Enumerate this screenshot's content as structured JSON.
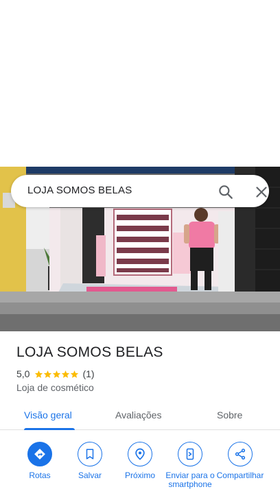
{
  "search": {
    "query": "LOJA SOMOS BELAS"
  },
  "place": {
    "name": "LOJA SOMOS BELAS",
    "rating": "5,0",
    "star_count": 5,
    "review_count": "(1)",
    "category": "Loja de cosmético"
  },
  "tabs": [
    {
      "label": "Visão geral",
      "active": true
    },
    {
      "label": "Avaliações",
      "active": false
    },
    {
      "label": "Sobre",
      "active": false
    }
  ],
  "actions": [
    {
      "label": "Rotas",
      "icon": "directions-icon"
    },
    {
      "label": "Salvar",
      "icon": "bookmark-icon"
    },
    {
      "label": "Próximo",
      "icon": "nearby-icon"
    },
    {
      "label": "Enviar para o smartphone",
      "icon": "send-to-phone-icon"
    },
    {
      "label": "Compartilhar",
      "icon": "share-icon"
    }
  ],
  "colors": {
    "accent": "#1a73e8",
    "star": "#fbbc04",
    "text": "#202124",
    "muted": "#5f6368"
  }
}
